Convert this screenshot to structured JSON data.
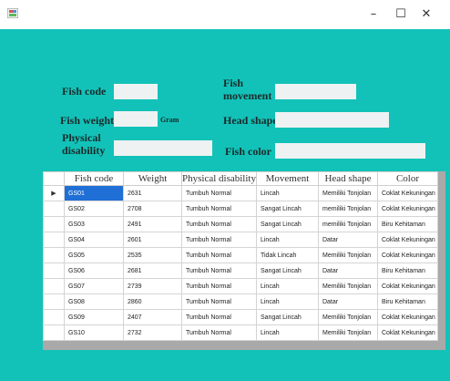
{
  "window": {
    "minimize_glyph": "–",
    "maximize_glyph": "☐",
    "close_glyph": "✕"
  },
  "form": {
    "fish_code_label": "Fish code",
    "fish_weight_label": "Fish weight",
    "weight_unit": "Gram",
    "physical_disability_label_1": "Physical",
    "physical_disability_label_2": "disability",
    "fish_movement_label_1": "Fish",
    "fish_movement_label_2": "movement",
    "head_shape_label": "Head shape",
    "fish_color_label": "Fish color",
    "fish_code_value": "",
    "fish_weight_value": "",
    "physical_disability_value": "",
    "fish_movement_value": "",
    "head_shape_value": "",
    "fish_color_value": ""
  },
  "grid": {
    "columns": [
      "Fish code",
      "Weight",
      "Physical disability",
      "Movement",
      "Head shape",
      "Color"
    ],
    "current_row_marker": "▶",
    "rows": [
      [
        "GS01",
        "2631",
        "Tumbuh Normal",
        "Lincah",
        "Memiliki Tonjolan",
        "Coklat Kekuningan"
      ],
      [
        "GS02",
        "2708",
        "Tumbuh Normal",
        "Sangat Lincah",
        "memiliki Tonjolan",
        "Coklat Kekuningan"
      ],
      [
        "GS03",
        "2491",
        "Tumbuh Normal",
        "Sangat Lincah",
        "memiliki Tonjolan",
        "Biru Kehitaman"
      ],
      [
        "GS04",
        "2601",
        "Tumbuh Normal",
        "Lincah",
        "Datar",
        "Coklat Kekuningan"
      ],
      [
        "GS05",
        "2535",
        "Tumbuh Normal",
        "Tidak Lincah",
        "Memiliki Tonjolan",
        "Coklat Kekuningan"
      ],
      [
        "GS06",
        "2681",
        "Tumbuh Normal",
        "Sangat Lincah",
        "Datar",
        "Biru Kehitaman"
      ],
      [
        "GS07",
        "2739",
        "Tumbuh Normal",
        "Lincah",
        "Memiliki Tonjolan",
        "Coklat Kekuningan"
      ],
      [
        "GS08",
        "2860",
        "Tumbuh Normal",
        "Lincah",
        "Datar",
        "Biru Kehitaman"
      ],
      [
        "GS09",
        "2407",
        "Tumbuh Normal",
        "Sangat Lincah",
        "Memiliki Tonjolan",
        "Coklat Kekuningan"
      ],
      [
        "GS10",
        "2732",
        "Tumbuh Normal",
        "Lincah",
        "Memiliki Tonjolan",
        "Coklat Kekuningan"
      ]
    ]
  },
  "colors": {
    "client_background": "#12c2b8",
    "selected_cell": "#1f6fd6",
    "grid_background": "#a9a9a9"
  }
}
